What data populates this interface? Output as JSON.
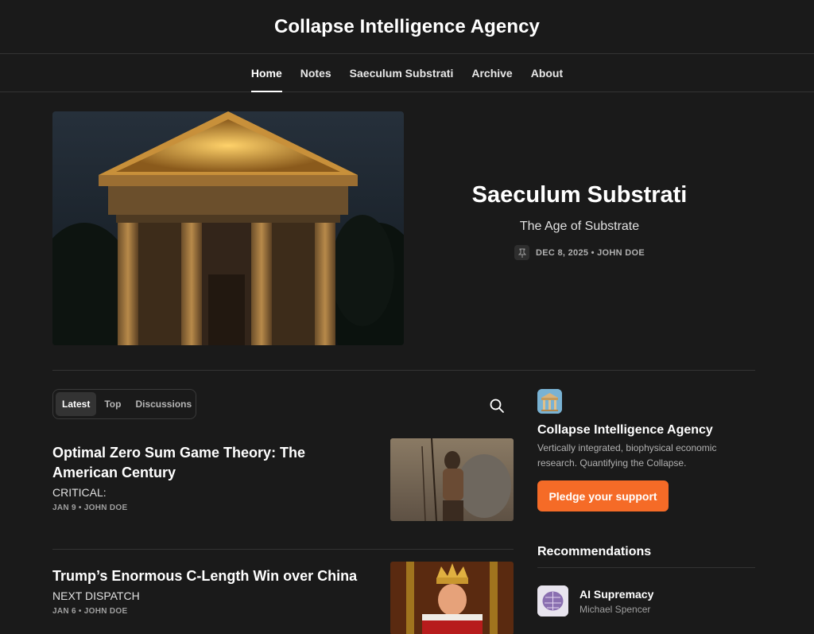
{
  "header": {
    "title": "Collapse Intelligence Agency"
  },
  "nav": {
    "items": [
      {
        "label": "Home",
        "active": true
      },
      {
        "label": "Notes"
      },
      {
        "label": "Saeculum Substrati"
      },
      {
        "label": "Archive"
      },
      {
        "label": "About"
      }
    ]
  },
  "hero": {
    "title": "Saeculum Substrati",
    "subtitle": "The Age of Substrate",
    "meta": "DEC 8, 2025 • JOHN DOE",
    "pin_icon": "pin-icon"
  },
  "tabs": {
    "items": [
      "Latest",
      "Top",
      "Discussions"
    ],
    "active": "Latest"
  },
  "posts": [
    {
      "title": "Optimal Zero Sum Game Theory: The American Century",
      "subtitle": "CRITICAL:",
      "meta": "JAN 9 • JOHN DOE"
    },
    {
      "title": "Trump’s Enormous C-Length Win over China",
      "subtitle": "NEXT DISPATCH",
      "meta": "JAN 6 • JOHN DOE"
    }
  ],
  "sidebar": {
    "name": "Collapse Intelligence Agency",
    "description": "Vertically integrated, biophysical economic research. Quantifying the Collapse.",
    "pledge_label": "Pledge your support",
    "recommendations_heading": "Recommendations",
    "recommendations": [
      {
        "name": "AI Supremacy",
        "author": "Michael Spencer"
      }
    ]
  },
  "colors": {
    "accent": "#f56b27",
    "background": "#1a1a1a"
  }
}
